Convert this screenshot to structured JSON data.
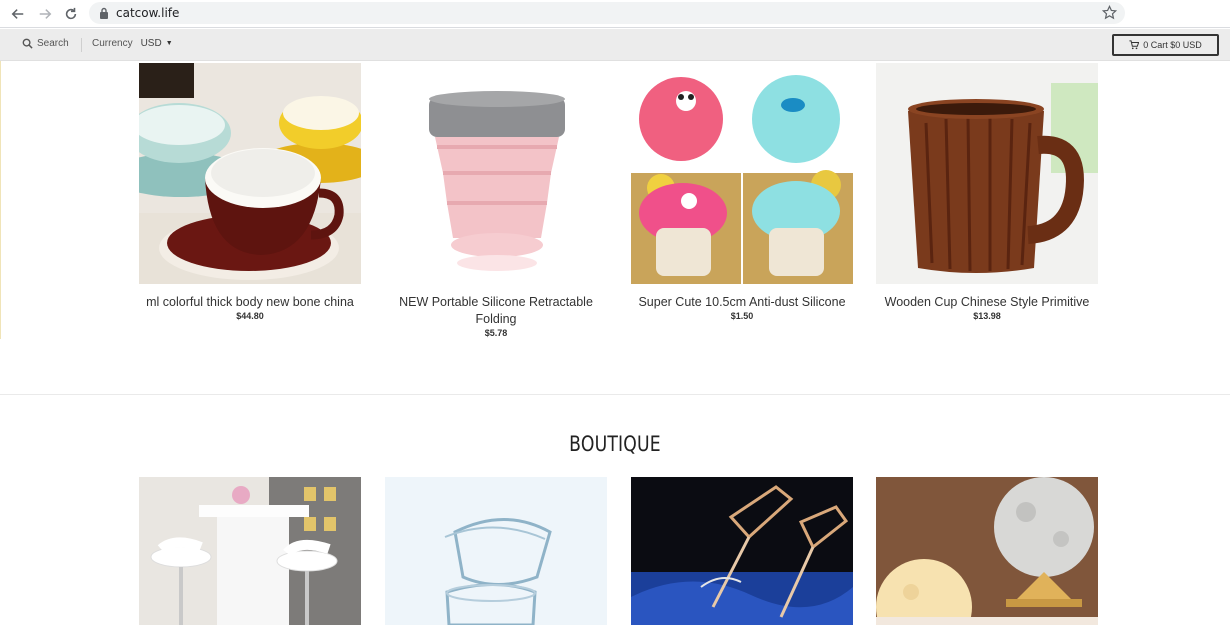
{
  "browser": {
    "url": "catcow.life",
    "icons": [
      "back-arrow-icon",
      "forward-arrow-icon",
      "reload-icon",
      "lock-icon",
      "star-icon"
    ]
  },
  "header": {
    "search_label": "Search",
    "currency_label": "Currency",
    "currency_value": "USD",
    "cart_label": "0 Cart $0 USD"
  },
  "products": [
    {
      "name": "ml colorful thick body new bone china",
      "price": "$44.80"
    },
    {
      "name": "NEW Portable Silicone Retractable Folding",
      "price": "$5.78"
    },
    {
      "name": "Super Cute 10.5cm Anti-dust Silicone",
      "price": "$1.50"
    },
    {
      "name": "Wooden Cup Chinese Style Primitive",
      "price": "$13.98"
    }
  ],
  "boutique": {
    "title": "BOUTIQUE"
  },
  "colors": {
    "header_bg": "#ececec",
    "text": "#333333"
  }
}
